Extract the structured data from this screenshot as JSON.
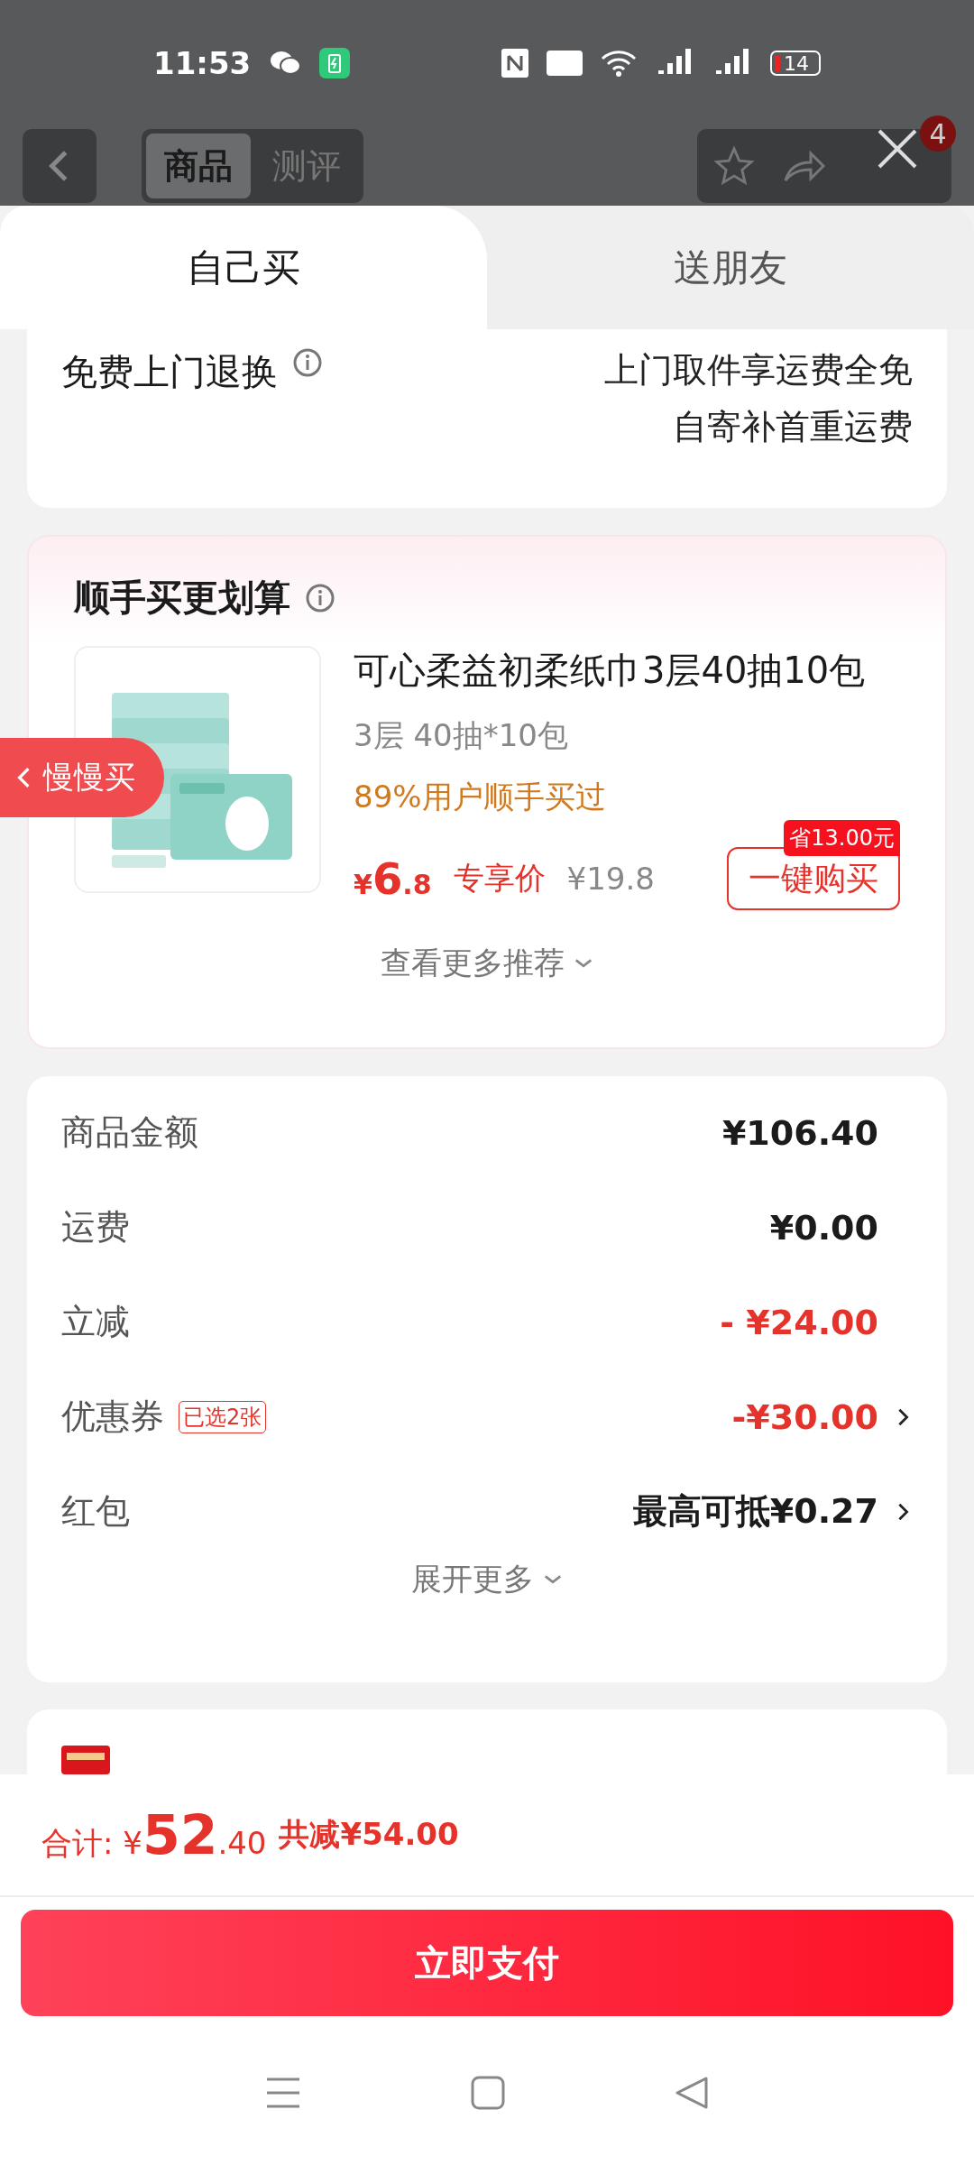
{
  "status_bar": {
    "time": "11:53",
    "battery": "14"
  },
  "header": {
    "tabs": [
      {
        "label": "商品",
        "selected": true
      },
      {
        "label": "测评",
        "selected": false
      }
    ],
    "badge": "4"
  },
  "sheet_tabs": [
    {
      "label": "自己买",
      "selected": true
    },
    {
      "label": "送朋友",
      "selected": false
    }
  ],
  "return_service": {
    "title": "免费上门退换",
    "lines": [
      "上门取件享运费全免",
      "自寄补首重运费"
    ]
  },
  "bundle": {
    "title": "顺手买更划算",
    "product": {
      "kind": "picture",
      "name": "可心柔益初柔纸巾3层40抽10包",
      "spec": "3层 40抽*10包",
      "social": "89%用户顺手买过",
      "price_symbol": "¥",
      "price_int": "6",
      "price_dec": ".8",
      "price_label": "专享价",
      "original_price": "¥19.8",
      "save_tag": "省13.00元",
      "buy_button": "一键购买"
    },
    "more": "查看更多推荐"
  },
  "float_tab": "慢慢买",
  "summary": {
    "rows": [
      {
        "label": "商品金额",
        "value": "¥106.40",
        "kind": "plain",
        "tag": null,
        "arrow": false
      },
      {
        "label": "运费",
        "value": "¥0.00",
        "kind": "plain",
        "tag": null,
        "arrow": false
      },
      {
        "label": "立减",
        "value": "- ¥24.00",
        "kind": "discount",
        "tag": null,
        "arrow": false
      },
      {
        "label": "优惠券",
        "value": "-¥30.00",
        "kind": "discount",
        "tag": "已选2张",
        "arrow": true
      },
      {
        "label": "红包",
        "value": "最高可抵¥0.27",
        "kind": "plain",
        "tag": null,
        "arrow": true
      }
    ],
    "more": "展开更多"
  },
  "footer": {
    "total_label": "合计: ",
    "symbol": "¥",
    "total_int": "52",
    "total_dec": ".40",
    "saved": "共减¥54.00",
    "pay_button": "立即支付"
  }
}
